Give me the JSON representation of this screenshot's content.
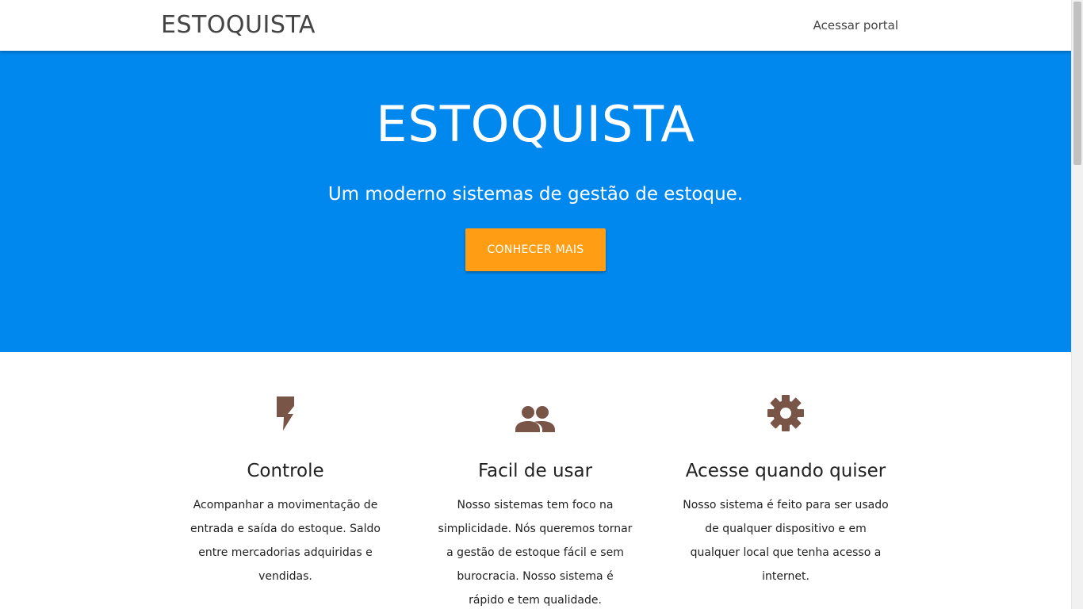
{
  "navbar": {
    "brand": "ESTOQUISTA",
    "portal_link": "Acessar portal"
  },
  "hero": {
    "title": "ESTOQUISTA",
    "subtitle": "Um moderno sistemas de gestão de estoque.",
    "cta_label": "CONHECER MAIS",
    "background_color": "#0088ee",
    "cta_color": "#ff9d14"
  },
  "features": [
    {
      "icon": "bolt-icon",
      "title": "Controle",
      "text": "Acompanhar a movimentação de entrada e saída do estoque. Saldo entre mercadorias adquiridas e vendidas."
    },
    {
      "icon": "people-icon",
      "title": "Facil de usar",
      "text": "Nosso sistemas tem foco na simplicidade. Nós queremos tornar a gestão de estoque fácil e sem burocracia. Nosso sistema é rápido e tem qualidade."
    },
    {
      "icon": "gear-icon",
      "title": "Acesse quando quiser",
      "text": "Nosso sistema é feito para ser usado de qualquer dispositivo e em qualquer local que tenha acesso a internet."
    }
  ],
  "icon_color": "#795548"
}
